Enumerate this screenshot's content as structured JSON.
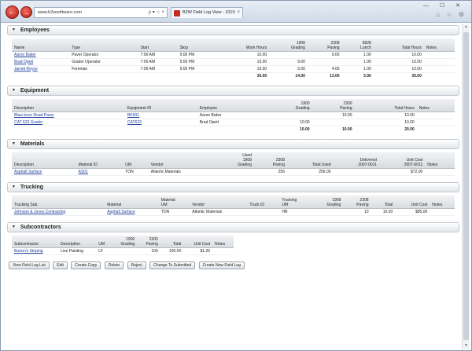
{
  "browser": {
    "address": "www.b2wsoftware.com",
    "address_controls": "ρ ▾ ☆ ×",
    "tab_title": "B2W Field Log View - 1010",
    "window_controls": "— ☐ ✕",
    "corner_icons": "⌂ ☆ ⚙",
    "back": "←",
    "forward": "→",
    "tab_close": "×"
  },
  "employees": {
    "title": "Employees",
    "columns": [
      "Name",
      "Type",
      "Start",
      "Stop",
      "Work Hours",
      "1908\nGrading",
      "2308\nPaving",
      "9828\nLunch",
      "Total Hours",
      "Notes"
    ],
    "rows": [
      [
        "Aaron Baker",
        "Paver Operator",
        "7:00 AM",
        "5:00 PM",
        "10.00",
        "",
        "9.00",
        "1.00",
        "10.00",
        ""
      ],
      [
        "Brad Opett",
        "Grader Operator",
        "7:00 AM",
        "5:00 PM",
        "10.00",
        "9.00",
        "",
        "1.00",
        "10.00",
        ""
      ],
      [
        "Jarrett Royce",
        "Foreman",
        "7:00 AM",
        "5:00 PM",
        "10.00",
        "5.00",
        "4.00",
        "1.00",
        "10.00",
        ""
      ]
    ],
    "totals": [
      "",
      "",
      "",
      "",
      "30.00",
      "14.00",
      "13.00",
      "3.00",
      "30.00",
      ""
    ]
  },
  "equipment": {
    "title": "Equipment",
    "columns": [
      "Description",
      "Equipment ID",
      "Employee",
      "1900\nGrading",
      "2300\nPaving",
      "Total Hours",
      "Notes"
    ],
    "rows": [
      [
        "Blaw-knox Road Paver",
        "BK001",
        "Aaron Baker",
        "",
        "10.00",
        "10.00",
        ""
      ],
      [
        "CAT 623 Grader",
        "CAT623",
        "Brad Opett",
        "10.00",
        "",
        "10.00",
        ""
      ]
    ],
    "totals": [
      "",
      "",
      "",
      "10.00",
      "10.00",
      "20.00",
      ""
    ]
  },
  "materials": {
    "title": "Materials",
    "columns": [
      "Description",
      "Material ID",
      "UM",
      "Vendor",
      "Used\n1908\nGrading",
      "2308\nPaving",
      "Total Used",
      "Delivered\n2007-0011",
      "Unit Cost\n2007-0011",
      "Notes"
    ],
    "rows": [
      [
        "Asphalt Surface",
        "AS01",
        "TON",
        "Atlantic Materials",
        "",
        "256",
        "256.00",
        "",
        "$72.00",
        ""
      ]
    ]
  },
  "trucking": {
    "title": "Trucking",
    "columns": [
      "Trucking Sub.",
      "Material",
      "Material\nUM",
      "Vendor",
      "Truck ID",
      "Trucking\nUM",
      "1908\nGrading",
      "2308\nPaving",
      "Total",
      "Unit Cost",
      "Notes"
    ],
    "rows": [
      [
        "Johnson & Jones Contracting",
        "Asphalt Surface",
        "TON",
        "Atlantic Materials",
        "",
        "HR",
        "",
        "10",
        "10.00",
        "$85.00",
        ""
      ]
    ]
  },
  "subcontractors": {
    "title": "Subcontractors",
    "columns": [
      "Subcontractor",
      "Description",
      "UM",
      "1900\nGrading",
      "2300\nPaving",
      "Total",
      "Unit Cost",
      "Notes"
    ],
    "rows": [
      [
        "Burton's Striping",
        "Line Painting",
        "LF",
        "",
        "100",
        "100.00",
        "$1.25",
        ""
      ]
    ]
  },
  "buttons": {
    "view_list": "View Field Log List",
    "edit": "Edit",
    "create_copy": "Create Copy",
    "delete": "Delete",
    "reject": "Reject",
    "change_submitted": "Change To Submitted",
    "create_new": "Create New Field Log"
  },
  "colors": {
    "link": "#1f3f9a",
    "nav_button": "#c52a1f"
  }
}
